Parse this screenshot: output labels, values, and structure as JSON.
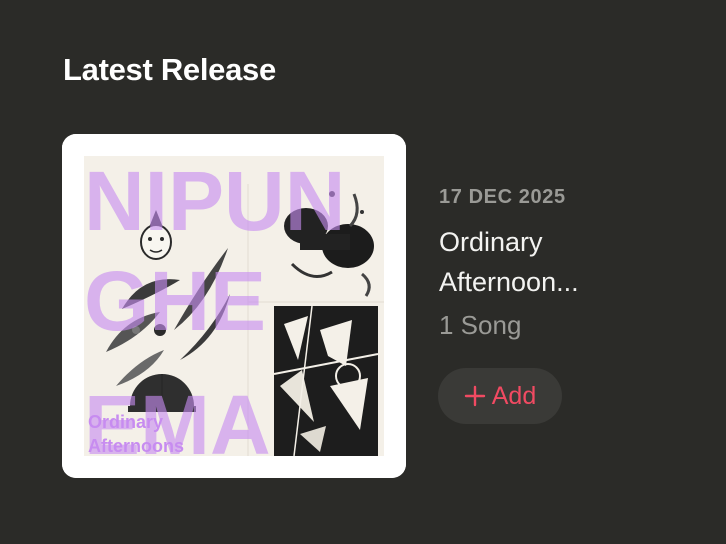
{
  "section": {
    "title": "Latest Release"
  },
  "release": {
    "date": "17 DEC 2025",
    "title": "Ordinary Afternoon...",
    "song_count": "1 Song",
    "add_label": "Add",
    "add_icon": "plus-icon",
    "accent_color": "#f14a62"
  },
  "artwork": {
    "artist_text_lines": [
      "NIPUN",
      "GHE",
      "EMA"
    ],
    "album_text_lines": [
      "Ordinary",
      "Afternoons"
    ],
    "text_color": "#c78cf0"
  }
}
